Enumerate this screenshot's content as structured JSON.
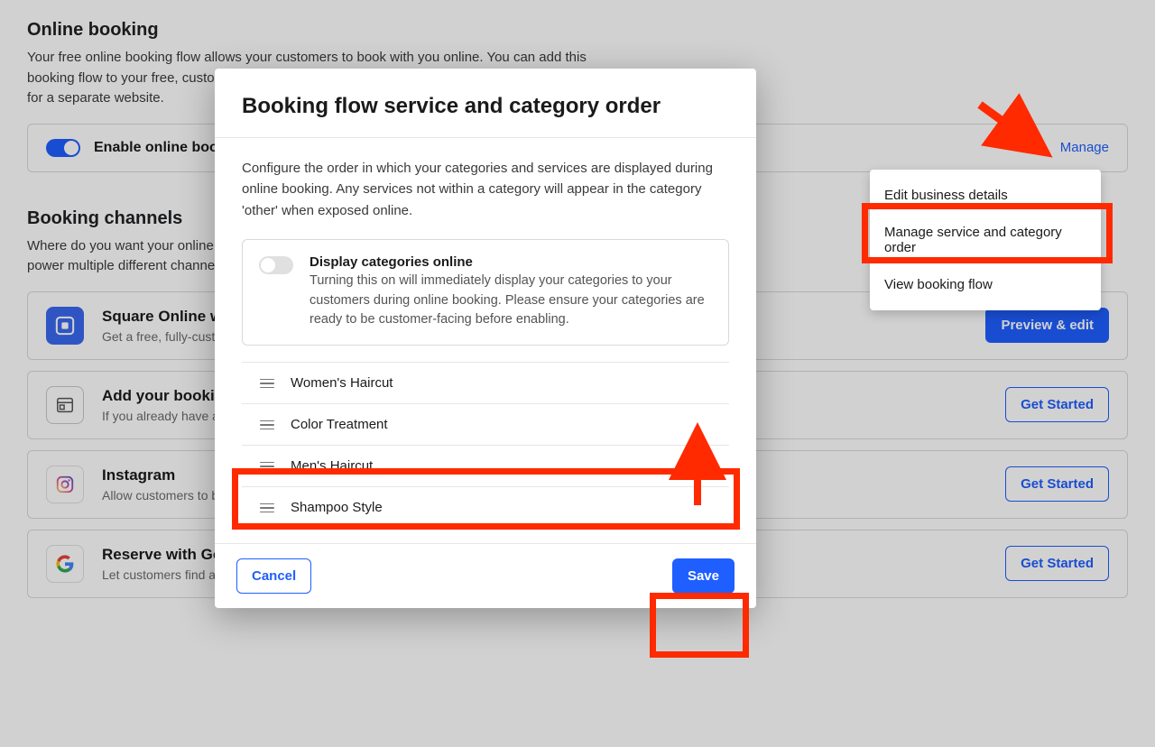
{
  "page": {
    "sections": {
      "online_booking": {
        "heading": "Online booking",
        "desc": "Your free online booking flow allows your customers to book with you online. You can add this booking flow to your free, customizable Square Online website, or generate booking buttons for a separate website.",
        "enable_label": "Enable online booking",
        "manage_label": "Manage"
      },
      "booking_channels": {
        "heading": "Booking channels",
        "desc": "Where do you want your online booking flow to appear? Your booking flow can be used to power multiple different channels."
      }
    },
    "channels": [
      {
        "title": "Square Online website",
        "sub": "Get a free, fully-customizable website with online booking built-in.",
        "button": "Preview & edit",
        "primary": true,
        "icon": "square"
      },
      {
        "title": "Add your booking flow to an existing website",
        "sub": "If you already have a website, embed your booking flow.",
        "button": "Get Started",
        "primary": false,
        "icon": "widget"
      },
      {
        "title": "Instagram",
        "sub": "Allow customers to book from your Instagram business profile.",
        "button": "Get Started",
        "primary": false,
        "icon": "instagram"
      },
      {
        "title": "Reserve with Google",
        "sub": "Let customers find and book with you through Google Search, Maps and the Reserve with Google site.",
        "button": "Get Started",
        "primary": false,
        "icon": "google"
      }
    ],
    "dropdown": {
      "items": [
        "Edit business details",
        "Manage service and category order",
        "View booking flow"
      ]
    }
  },
  "modal": {
    "title": "Booking flow service and category order",
    "desc": "Configure the order in which your categories and services are displayed during online booking. Any services not within a category will appear in the category 'other' when exposed online.",
    "setting": {
      "title": "Display categories online",
      "desc": "Turning this on will immediately display your categories to your customers during online booking. Please ensure your categories are ready to be customer-facing before enabling."
    },
    "items": [
      "Women's Haircut",
      "Color Treatment",
      "Men's Haircut",
      "Shampoo Style"
    ],
    "cancel": "Cancel",
    "save": "Save"
  }
}
